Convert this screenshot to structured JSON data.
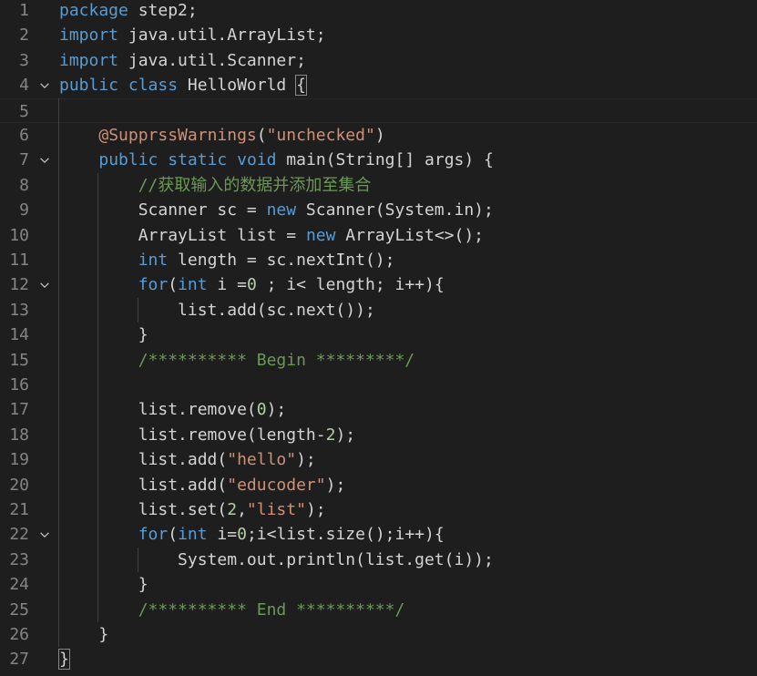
{
  "editor": {
    "lines": [
      {
        "n": "1",
        "fold": false,
        "tokens": [
          {
            "t": "package",
            "c": "kw"
          },
          {
            "t": " step2;",
            "c": "plain"
          }
        ]
      },
      {
        "n": "2",
        "fold": false,
        "tokens": [
          {
            "t": "import",
            "c": "kw"
          },
          {
            "t": " java.util.ArrayList;",
            "c": "plain"
          }
        ]
      },
      {
        "n": "3",
        "fold": false,
        "tokens": [
          {
            "t": "import",
            "c": "kw"
          },
          {
            "t": " java.util.Scanner;",
            "c": "plain"
          }
        ]
      },
      {
        "n": "4",
        "fold": true,
        "tokens": [
          {
            "t": "public",
            "c": "kw"
          },
          {
            "t": " ",
            "c": "plain"
          },
          {
            "t": "class",
            "c": "kw"
          },
          {
            "t": " HelloWorld ",
            "c": "plain"
          },
          {
            "t": "{",
            "c": "plain",
            "box": true
          }
        ]
      },
      {
        "n": "5",
        "fold": false,
        "current": true,
        "tokens": []
      },
      {
        "n": "6",
        "fold": false,
        "tokens": [
          {
            "t": "    ",
            "c": "plain"
          },
          {
            "t": "@SupprssWarnings",
            "c": "ann"
          },
          {
            "t": "(",
            "c": "plain"
          },
          {
            "t": "\"unchecked\"",
            "c": "str"
          },
          {
            "t": ")",
            "c": "plain"
          }
        ]
      },
      {
        "n": "7",
        "fold": true,
        "tokens": [
          {
            "t": "    ",
            "c": "plain"
          },
          {
            "t": "public",
            "c": "kw"
          },
          {
            "t": " ",
            "c": "plain"
          },
          {
            "t": "static",
            "c": "kw"
          },
          {
            "t": " ",
            "c": "plain"
          },
          {
            "t": "void",
            "c": "kw"
          },
          {
            "t": " main(String[] args) {",
            "c": "plain"
          }
        ]
      },
      {
        "n": "8",
        "fold": false,
        "tokens": [
          {
            "t": "        ",
            "c": "plain"
          },
          {
            "t": "//获取输入的数据并添加至集合",
            "c": "cmt"
          }
        ]
      },
      {
        "n": "9",
        "fold": false,
        "tokens": [
          {
            "t": "        Scanner sc = ",
            "c": "plain"
          },
          {
            "t": "new",
            "c": "kw"
          },
          {
            "t": " Scanner(System.in);",
            "c": "plain"
          }
        ]
      },
      {
        "n": "10",
        "fold": false,
        "tokens": [
          {
            "t": "        ArrayList list = ",
            "c": "plain"
          },
          {
            "t": "new",
            "c": "kw"
          },
          {
            "t": " ArrayList<>();",
            "c": "plain"
          }
        ]
      },
      {
        "n": "11",
        "fold": false,
        "tokens": [
          {
            "t": "        ",
            "c": "plain"
          },
          {
            "t": "int",
            "c": "kw"
          },
          {
            "t": " length = sc.nextInt();",
            "c": "plain"
          }
        ]
      },
      {
        "n": "12",
        "fold": true,
        "tokens": [
          {
            "t": "        ",
            "c": "plain"
          },
          {
            "t": "for",
            "c": "kw"
          },
          {
            "t": "(",
            "c": "plain"
          },
          {
            "t": "int",
            "c": "kw"
          },
          {
            "t": " i =",
            "c": "plain"
          },
          {
            "t": "0",
            "c": "num"
          },
          {
            "t": " ; i< length; i++){",
            "c": "plain"
          }
        ]
      },
      {
        "n": "13",
        "fold": false,
        "tokens": [
          {
            "t": "            list.add(sc.next());",
            "c": "plain"
          }
        ]
      },
      {
        "n": "14",
        "fold": false,
        "tokens": [
          {
            "t": "        }",
            "c": "plain"
          }
        ]
      },
      {
        "n": "15",
        "fold": false,
        "tokens": [
          {
            "t": "        ",
            "c": "plain"
          },
          {
            "t": "/********** Begin *********/",
            "c": "cmt"
          }
        ]
      },
      {
        "n": "16",
        "fold": false,
        "tokens": []
      },
      {
        "n": "17",
        "fold": false,
        "tokens": [
          {
            "t": "        list.remove(",
            "c": "plain"
          },
          {
            "t": "0",
            "c": "num"
          },
          {
            "t": ");",
            "c": "plain"
          }
        ]
      },
      {
        "n": "18",
        "fold": false,
        "tokens": [
          {
            "t": "        list.remove(length-",
            "c": "plain"
          },
          {
            "t": "2",
            "c": "num"
          },
          {
            "t": ");",
            "c": "plain"
          }
        ]
      },
      {
        "n": "19",
        "fold": false,
        "tokens": [
          {
            "t": "        list.add(",
            "c": "plain"
          },
          {
            "t": "\"hello\"",
            "c": "str"
          },
          {
            "t": ");",
            "c": "plain"
          }
        ]
      },
      {
        "n": "20",
        "fold": false,
        "tokens": [
          {
            "t": "        list.add(",
            "c": "plain"
          },
          {
            "t": "\"educoder\"",
            "c": "str"
          },
          {
            "t": ");",
            "c": "plain"
          }
        ]
      },
      {
        "n": "21",
        "fold": false,
        "tokens": [
          {
            "t": "        list.set(",
            "c": "plain"
          },
          {
            "t": "2",
            "c": "num"
          },
          {
            "t": ",",
            "c": "plain"
          },
          {
            "t": "\"list\"",
            "c": "str"
          },
          {
            "t": ");",
            "c": "plain"
          }
        ]
      },
      {
        "n": "22",
        "fold": true,
        "tokens": [
          {
            "t": "        ",
            "c": "plain"
          },
          {
            "t": "for",
            "c": "kw"
          },
          {
            "t": "(",
            "c": "plain"
          },
          {
            "t": "int",
            "c": "kw"
          },
          {
            "t": " i=",
            "c": "plain"
          },
          {
            "t": "0",
            "c": "num"
          },
          {
            "t": ";i<list.size();i++){",
            "c": "plain"
          }
        ]
      },
      {
        "n": "23",
        "fold": false,
        "tokens": [
          {
            "t": "            System.out.println(list.get(i));",
            "c": "plain"
          }
        ]
      },
      {
        "n": "24",
        "fold": false,
        "tokens": [
          {
            "t": "        }",
            "c": "plain"
          }
        ]
      },
      {
        "n": "25",
        "fold": false,
        "tokens": [
          {
            "t": "        ",
            "c": "plain"
          },
          {
            "t": "/********** End **********/",
            "c": "cmt"
          }
        ]
      },
      {
        "n": "26",
        "fold": false,
        "tokens": [
          {
            "t": "    }",
            "c": "plain"
          }
        ]
      },
      {
        "n": "27",
        "fold": false,
        "tokens": [
          {
            "t": "}",
            "c": "plain",
            "box": true
          }
        ]
      }
    ]
  },
  "colors": {
    "background": "#1e1e1e",
    "keyword": "#569cd6",
    "string": "#ce9178",
    "number": "#b5cea8",
    "comment": "#6a9955",
    "text": "#d4d4d4",
    "line_number": "#858585"
  },
  "icons": {
    "fold": "chevron-down-icon"
  }
}
